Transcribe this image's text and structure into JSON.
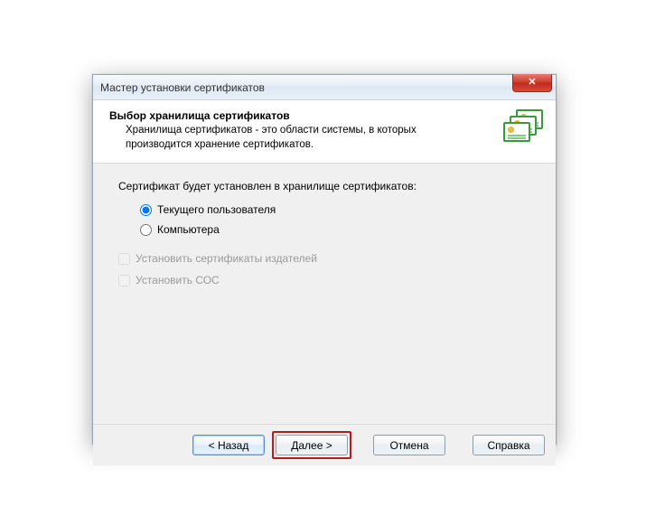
{
  "window": {
    "title": "Мастер установки сертификатов"
  },
  "header": {
    "title": "Выбор хранилища сертификатов",
    "subtitle": "Хранилища сертификатов - это области системы, в которых производится хранение сертификатов."
  },
  "content": {
    "intro": "Сертификат будет установлен в хранилище сертификатов:",
    "radio_user": "Текущего пользователя",
    "radio_computer": "Компьютера",
    "check_publishers": "Установить сертификаты издателей",
    "check_crl": "Установить СОС"
  },
  "buttons": {
    "back": "< Назад",
    "next": "Далее >",
    "cancel": "Отмена",
    "help": "Справка"
  }
}
